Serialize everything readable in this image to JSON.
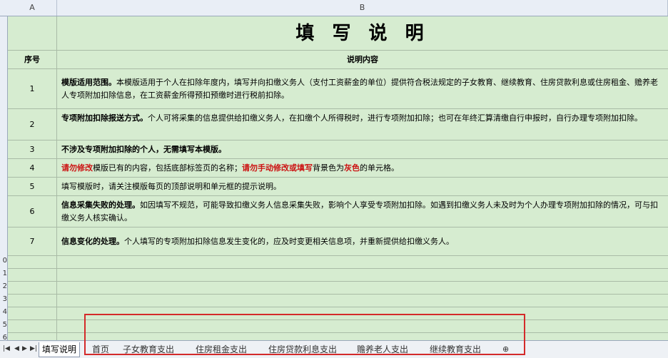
{
  "columns": {
    "a": "A",
    "b": "B"
  },
  "title": "填 写 说 明",
  "header": {
    "no": "序号",
    "content": "说明内容"
  },
  "rows": [
    {
      "no": "1",
      "bold": "模版适用范围。",
      "text": "本模版适用于个人在扣除年度内，填写并向扣缴义务人（支付工资薪金的单位）提供符合税法规定的子女教育、继续教育、住房贷款利息或住房租金、赡养老人专项附加扣除信息，在工资薪金所得预扣预缴时进行税前扣除。"
    },
    {
      "no": "2",
      "bold": "专项附加扣除报送方式。",
      "text": "个人可将采集的信息提供给扣缴义务人，在扣缴个人所得税时，进行专项附加扣除；也可在年终汇算清缴自行申报时，自行办理专项附加扣除。"
    },
    {
      "no": "3",
      "bold": "不涉及专项附加扣除的个人，无需填写本模版。",
      "text": ""
    },
    {
      "no": "4",
      "r1": "请勿修改",
      "t1": "模版已有的内容，包括底部标签页的名称；",
      "r2": "请勿手动修改或填写",
      "t2": "背景色为",
      "r3": "灰色",
      "t3": "的单元格。"
    },
    {
      "no": "5",
      "bold": "",
      "text": "填写模版时，请关注模版每页的顶部说明和单元框的提示说明。"
    },
    {
      "no": "6",
      "bold": "信息采集失败的处理。",
      "text": "如因填写不规范，可能导致扣缴义务人信息采集失败，影响个人享受专项附加扣除。如遇到扣缴义务人未及时为个人办理专项附加扣除的情况，可与扣缴义务人核实确认。"
    },
    {
      "no": "7",
      "bold": "信息变化的处理。",
      "text": "个人填写的专项附加扣除信息发生变化的，应及时变更相关信息项，并重新提供给扣缴义务人。"
    }
  ],
  "row_numbers": [
    "0",
    "1",
    "2",
    "3",
    "4",
    "5",
    "6"
  ],
  "tabs": [
    "填写说明",
    "首页",
    "子女教育支出",
    "住房租金支出",
    "住房贷款利息支出",
    "赡养老人支出",
    "继续教育支出"
  ],
  "colors": {
    "accent_red": "#cc1111",
    "cell_green": "#d6ecd0",
    "highlight_box": "#d42a2a"
  }
}
